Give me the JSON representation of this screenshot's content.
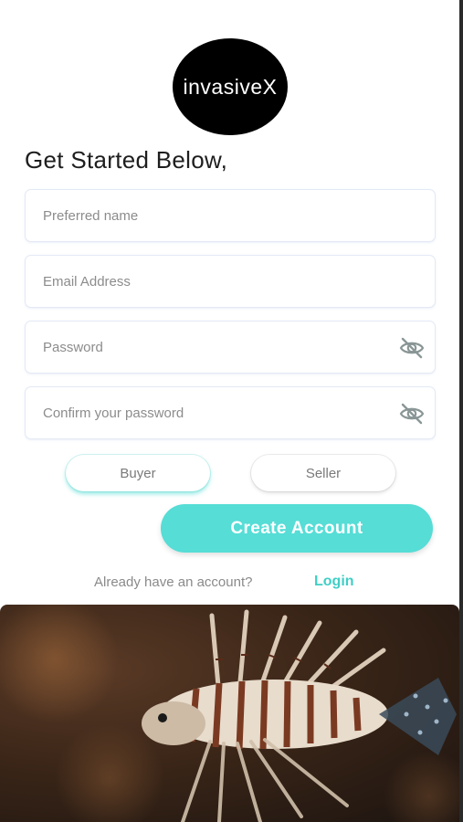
{
  "logo": {
    "text": "invasiveX"
  },
  "heading": "Get Started Below,",
  "fields": [
    {
      "placeholder": "Preferred name",
      "type": "text"
    },
    {
      "placeholder": "Email Address",
      "type": "email"
    },
    {
      "placeholder": "Password",
      "type": "password",
      "icon": "eye-slash-icon"
    },
    {
      "placeholder": "Confirm your password",
      "type": "password",
      "icon": "eye-slash-icon"
    }
  ],
  "roles": {
    "buyer": "Buyer",
    "seller": "Seller",
    "selected": "Buyer"
  },
  "create_button": "Create Account",
  "account_prompt": {
    "text": "Already have an account?",
    "link": "Login"
  },
  "colors": {
    "accent": "#55ddd6",
    "link": "#3fcfc6",
    "logo_bg": "#000000"
  },
  "image": {
    "subject": "lionfish"
  }
}
